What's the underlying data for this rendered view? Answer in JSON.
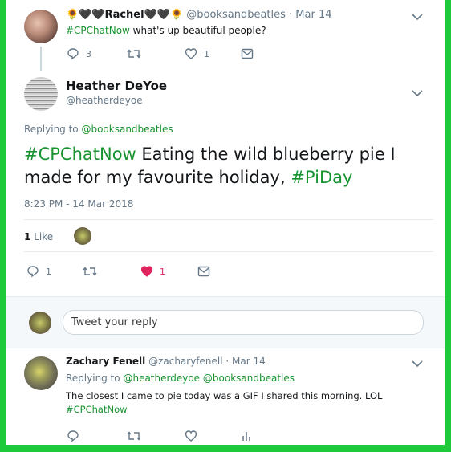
{
  "tweet1": {
    "name": "🌻🖤🖤Rachel🖤🖤🌻",
    "handle_date": "@booksandbeatles · Mar 14",
    "hashtag": "#CPChatNow",
    "text": " what's up beautiful people?",
    "replies": "3",
    "likes": "1"
  },
  "main_tweet": {
    "name": "Heather DeYoe",
    "handle": "@heatherdeyoe",
    "replying_prefix": "Replying to ",
    "replying_to": "@booksandbeatles",
    "hashtag1": "#CPChatNow",
    "text_middle": " Eating the wild blueberry pie I made for my favourite holiday, ",
    "hashtag2": "#PiDay",
    "timestamp": "8:23 PM - 14 Mar 2018",
    "like_count": "1",
    "like_label": "Like",
    "replies": "1",
    "likes": "1"
  },
  "reply_box": {
    "placeholder": "Tweet your reply"
  },
  "tweet3": {
    "name": "Zachary Fenell",
    "handle_date": "@zacharyfenell · Mar 14",
    "replying_prefix": "Replying to ",
    "replying_to_1": "@heatherdeyoe",
    "replying_to_2": "@booksandbeatles",
    "text": "The closest I came to pie today was a GIF I shared this morning. LOL",
    "hashtag": "#CPChatNow"
  },
  "colors": {
    "border": "#1ec93a",
    "hashtag": "#17932f",
    "muted": "#657786",
    "heart": "#e0245e"
  },
  "icons": [
    "reply-icon",
    "retweet-icon",
    "like-icon",
    "dm-icon",
    "chevron-down-icon",
    "analytics-icon"
  ]
}
